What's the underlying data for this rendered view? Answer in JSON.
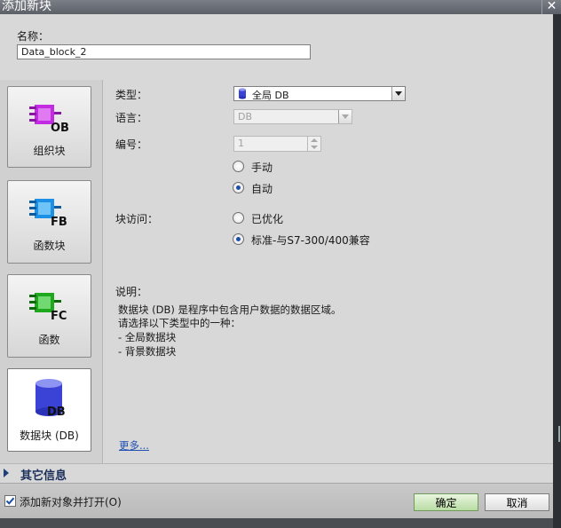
{
  "window": {
    "title": "添加新块",
    "close_symbol": "✕"
  },
  "name_field": {
    "label": "名称：",
    "value": "Data_block_2"
  },
  "block_types": [
    {
      "label": "组织块",
      "icon_text": "OB",
      "color": "#c02be0"
    },
    {
      "label": "函数块",
      "icon_text": "FB",
      "color": "#1f8fe0"
    },
    {
      "label": "函数",
      "icon_text": "FC",
      "color": "#1ea81e"
    },
    {
      "label": "数据块 (DB)",
      "icon_text": "DB",
      "color": "#3a43d6",
      "selected": true
    }
  ],
  "form": {
    "type_label": "类型：",
    "type_value": "全局 DB",
    "language_label": "语言：",
    "language_value": "DB",
    "number_label": "编号：",
    "number_value": "1",
    "manual_label": "手动",
    "auto_label": "自动",
    "numbering_selected": "auto",
    "access_label": "块访问：",
    "optimized_label": "已优化",
    "standard_label": "标准-与S7-300/400兼容",
    "access_selected": "standard"
  },
  "description": {
    "label": "说明：",
    "lines": [
      "数据块 (DB) 是程序中包含用户数据的数据区域。",
      "请选择以下类型中的一种：",
      "- 全局数据块",
      "- 背景数据块"
    ],
    "more_link": "更多..."
  },
  "other_info": {
    "label": "其它信息"
  },
  "footer": {
    "open_checkbox_label": "添加新对象并打开(O)",
    "open_checked": true,
    "ok_label": "确定",
    "cancel_label": "取消"
  }
}
